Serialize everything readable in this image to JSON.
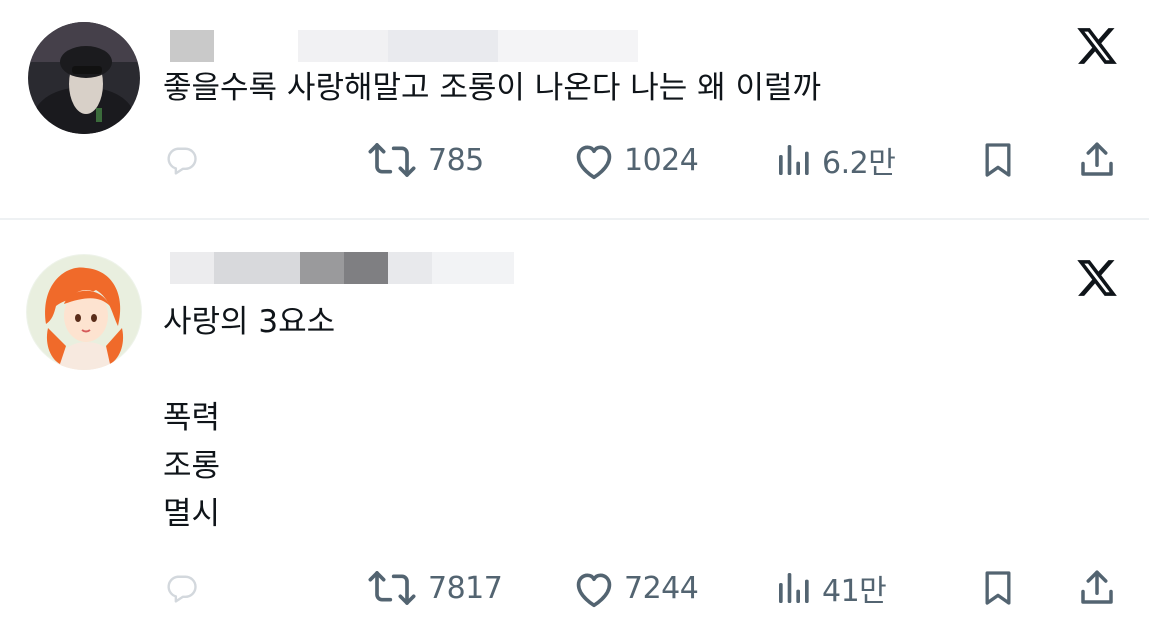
{
  "colors": {
    "text": "#0f1419",
    "secondary": "#536471",
    "divider": "#eef1f3",
    "background": "#ffffff"
  },
  "icons": {
    "brand": "x-logo-icon",
    "reply": "reply-icon",
    "repost": "repost-icon",
    "like": "heart-icon",
    "views": "views-bar-chart-icon",
    "bookmark": "bookmark-icon",
    "share": "share-icon"
  },
  "posts": [
    {
      "author_redacted": true,
      "text": "좋을수록 사랑해말고 조롱이 나온다 나는 왜 이럴까",
      "reposts": "785",
      "likes": "1024",
      "views": "6.2만"
    },
    {
      "author_redacted": true,
      "text": "사랑의 3요소\n\n폭력\n조롱\n멸시",
      "reposts": "7817",
      "likes": "7244",
      "views": "41만"
    }
  ]
}
